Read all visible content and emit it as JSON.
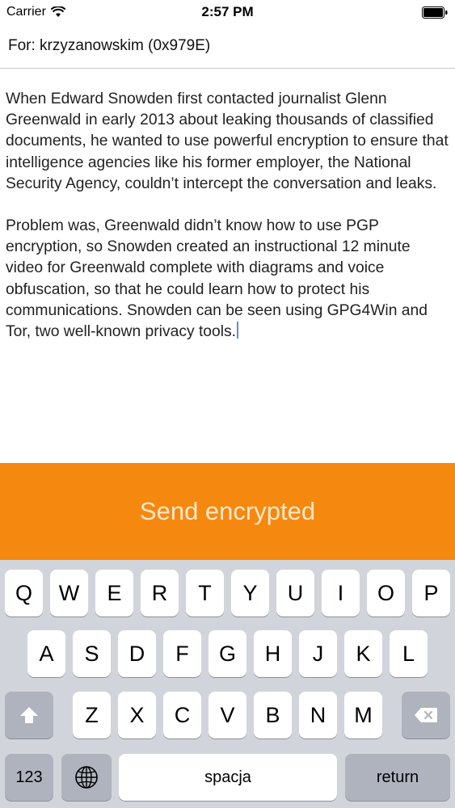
{
  "status_bar": {
    "carrier": "Carrier",
    "time": "2:57 PM"
  },
  "recipient": {
    "text": "For: krzyzanowskim (0x979E)"
  },
  "message": {
    "paragraphs": [
      "When Edward Snowden first contacted journalist Glenn Greenwald in early 2013 about leaking thousands of classified documents, he wanted to use powerful encryption to ensure that intelligence agencies like his former employer, the National Security Agency, couldn’t intercept the conversation and leaks.",
      "Problem was, Greenwald didn’t know how to use PGP encryption, so Snowden created an instructional 12 minute video for Greenwald complete with diagrams and voice obfuscation, so that he could learn how to protect his communications. Snowden can be seen using GPG4Win and Tor, two well-known privacy tools."
    ]
  },
  "send_button": {
    "label": "Send encrypted"
  },
  "keyboard": {
    "row1": [
      "Q",
      "W",
      "E",
      "R",
      "T",
      "Y",
      "U",
      "I",
      "O",
      "P"
    ],
    "row2": [
      "A",
      "S",
      "D",
      "F",
      "G",
      "H",
      "J",
      "K",
      "L"
    ],
    "row3": [
      "Z",
      "X",
      "C",
      "V",
      "B",
      "N",
      "M"
    ],
    "numbers_label": "123",
    "space_label": "spacja",
    "return_label": "return"
  },
  "colors": {
    "accent": "#f5890f",
    "keyboard_bg": "#d1d5db",
    "caret": "#5b8fd8"
  }
}
